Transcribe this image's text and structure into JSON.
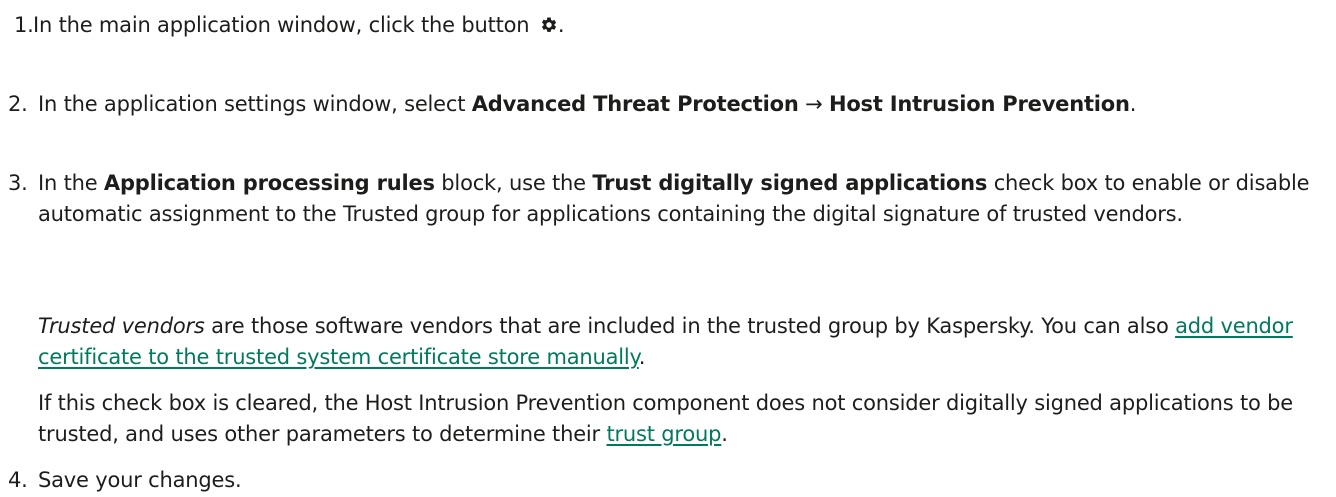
{
  "steps": [
    {
      "number": "1.",
      "text_before_icon": "In the main application window, click the button ",
      "icon": "gear-icon",
      "text_after_icon": "."
    },
    {
      "number": "2.",
      "text_1": "In the application settings window, select ",
      "bold_1": "Advanced Threat Protection",
      "arrow": " → ",
      "bold_2": "Host Intrusion Prevention",
      "text_2": "."
    },
    {
      "number": "3.",
      "text_1": "In the ",
      "bold_1": "Application processing rules",
      "text_2": " block, use the ",
      "bold_2": "Trust digitally signed applications",
      "text_3": " check box to enable or disable automatic assignment to the Trusted group for applications containing the digital signature of trusted vendors.",
      "note_1_italic": "Trusted vendors",
      "note_1_text": " are those software vendors that are included in the trusted group by Kaspersky. You can also ",
      "note_1_link": "add vendor certificate to the trusted system certificate store manually",
      "note_1_end": ".",
      "note_2_text": "If this check box is cleared, the Host Intrusion Prevention component does not consider digitally signed applications to be trusted, and uses other parameters to determine their ",
      "note_2_link": "trust group",
      "note_2_end": "."
    },
    {
      "number": "4.",
      "text": "Save your changes."
    }
  ],
  "colors": {
    "text": "#1d1d1b",
    "link": "#007a5e"
  }
}
